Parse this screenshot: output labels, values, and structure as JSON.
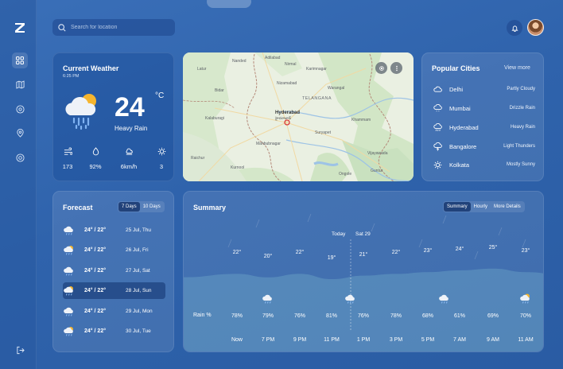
{
  "search": {
    "placeholder": "Search for location"
  },
  "current": {
    "title": "Current Weather",
    "time": "6:25 PM",
    "temp": "24",
    "unit": "°C",
    "condition": "Heavy Rain",
    "stats": [
      {
        "icon": "wind-icon",
        "value": "173"
      },
      {
        "icon": "humidity-drop-icon",
        "value": "92%"
      },
      {
        "icon": "wind-speed-icon",
        "value": "6km/h"
      },
      {
        "icon": "uv-sun-icon",
        "value": "3"
      }
    ]
  },
  "map": {
    "labels": {
      "hyderabad": "Hyderabad",
      "hyderabad_native": "హైదరాబాద్",
      "telangana": "TELANGANA",
      "adilabad": "Adilabad",
      "nirmal": "Nirmal",
      "karimnagar": "Karimnagar",
      "warangal": "Warangal",
      "nizamabad": "Nizamabad",
      "khammam": "Khammam",
      "kalaburagi": "Kalaburagi",
      "mahbubnagar": "Mahbubnagar",
      "suryapet": "Suryapet",
      "kurnool": "Kurnool",
      "vijayawada": "Vijayawada",
      "guntur": "Guntur",
      "bidar": "Bidar",
      "latur": "Latur",
      "raichur": "Raichur",
      "nanded": "Nanded",
      "ongole": "Ongole"
    }
  },
  "popular": {
    "title": "Popular Cities",
    "view_more": "View more",
    "cities": [
      {
        "icon": "cloud-icon",
        "name": "Delhi",
        "condition": "Partly Cloudy"
      },
      {
        "icon": "cloud-drizzle-icon",
        "name": "Mumbai",
        "condition": "Drizzle Rain"
      },
      {
        "icon": "cloud-rain-icon",
        "name": "Hyderabad",
        "condition": "Heavy Rain"
      },
      {
        "icon": "cloud-lightning-icon",
        "name": "Bangalore",
        "condition": "Light Thunders"
      },
      {
        "icon": "sun-icon",
        "name": "Kolkata",
        "condition": "Mostly Sunny"
      }
    ]
  },
  "forecast": {
    "title": "Forecast",
    "tabs": [
      "7 Days",
      "10 Days"
    ],
    "days": [
      {
        "temp": "24° / 22°",
        "date": "25 Jul, Thu"
      },
      {
        "temp": "24° / 22°",
        "date": "26 Jul, Fri"
      },
      {
        "temp": "24° / 22°",
        "date": "27 Jul, Sat"
      },
      {
        "temp": "24° / 22°",
        "date": "28 Jul, Sun"
      },
      {
        "temp": "24° / 22°",
        "date": "29 Jul, Mon"
      },
      {
        "temp": "24° / 22°",
        "date": "30 Jul, Tue"
      }
    ],
    "selected_index": 3
  },
  "summary": {
    "title": "Summary",
    "tabs": [
      "Summary",
      "Hourly",
      "More Details"
    ],
    "today": "Today",
    "next_day": "Sat 29",
    "rain_label": "Rain %",
    "temps": [
      "22°",
      "20°",
      "22°",
      "19°",
      "21°",
      "22°",
      "23°",
      "24°",
      "25°",
      "23°"
    ],
    "rain": [
      "78%",
      "79%",
      "76%",
      "81%",
      "76%",
      "78%",
      "68%",
      "61%",
      "69%",
      "70%"
    ],
    "times": [
      "Now",
      "7 PM",
      "9 PM",
      "11 PM",
      "1 PM",
      "3 PM",
      "5 PM",
      "7 AM",
      "9 AM",
      "11 AM"
    ]
  },
  "colors": {
    "background": "#2f63ac",
    "card": "#ffffff1a",
    "accent_sun": "#f5b52e"
  }
}
